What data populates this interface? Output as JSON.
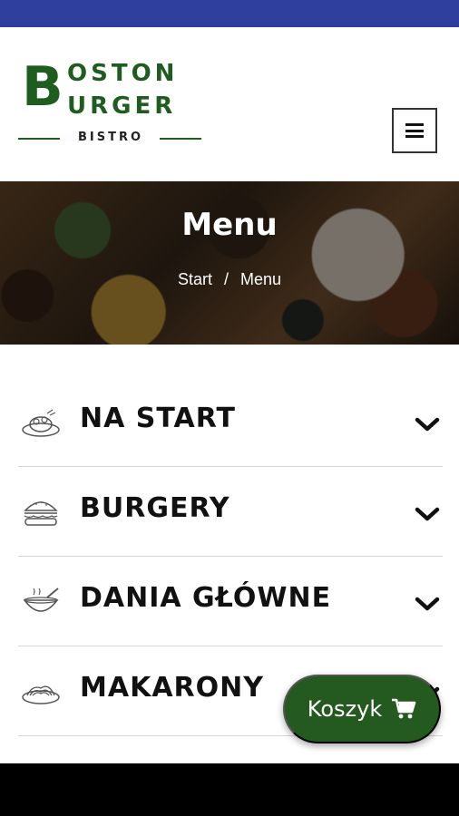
{
  "brand": {
    "logo_initial": "B",
    "line1": "OSTON",
    "line2": "URGER",
    "sub": "BISTRO",
    "color": "#1f5c1f"
  },
  "header": {
    "menu_icon": "hamburger-icon"
  },
  "hero": {
    "title": "Menu",
    "breadcrumb": {
      "home": "Start",
      "separator": "/",
      "current": "Menu"
    }
  },
  "categories": [
    {
      "label": "NA START",
      "icon": "starter-plate-icon"
    },
    {
      "label": "BURGERY",
      "icon": "burger-icon"
    },
    {
      "label": "DANIA GŁÓWNE",
      "icon": "bowl-icon"
    },
    {
      "label": "MAKARONY",
      "icon": "pasta-icon"
    }
  ],
  "cart": {
    "label": "Koszyk",
    "icon": "cart-icon",
    "color": "#245a1f"
  },
  "colors": {
    "status_bar": "#2f3f9e",
    "accent_green": "#1f5c1f"
  }
}
